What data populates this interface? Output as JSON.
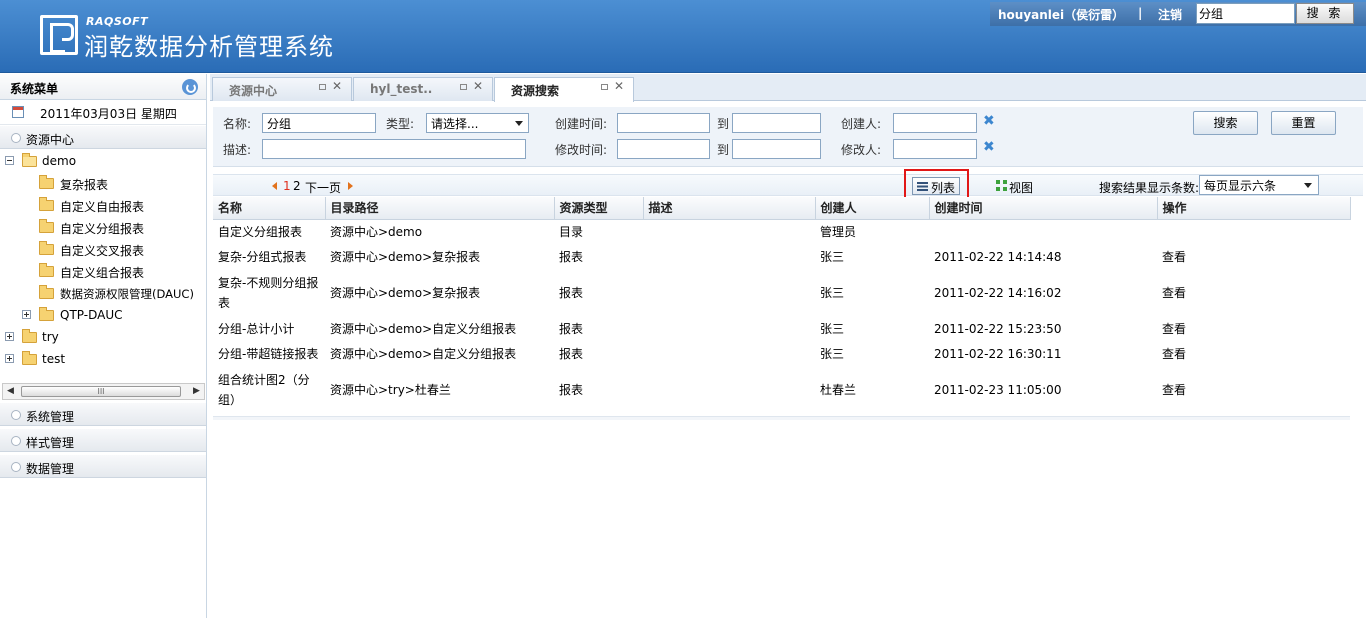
{
  "header": {
    "brand_sub": "RAQSOFT",
    "brand_title": "润乾数据分析管理系统",
    "user": "houyanlei（侯衍雷）",
    "separator": "|",
    "logout": "注销",
    "search_value": "分组",
    "search_button": "搜 索"
  },
  "sidebar": {
    "title": "系统菜单",
    "date": "2011年03月03日  星期四",
    "resource_center": "资源中心",
    "tree": {
      "demo": "demo",
      "items": [
        "复杂报表",
        "自定义自由报表",
        "自定义分组报表",
        "自定义交叉报表",
        "自定义组合报表",
        "数据资源权限管理(DAUC)"
      ],
      "qtp": "QTP-DAUC",
      "try": "try",
      "test": "test"
    },
    "scroll_grip": "III",
    "sections": [
      "系统管理",
      "样式管理",
      "数据管理"
    ]
  },
  "tabs": [
    {
      "label": "资源中心"
    },
    {
      "label": "hyl_test.."
    },
    {
      "label": "资源搜索"
    }
  ],
  "tab_close": "✕",
  "form": {
    "name_label": "名称:",
    "name_value": "分组",
    "type_label": "类型:",
    "type_value": "请选择...",
    "desc_label": "描述:",
    "desc_value": "",
    "created_label": "创建时间:",
    "modified_label": "修改时间:",
    "to_label": "到",
    "creator_label": "创建人:",
    "modifier_label": "修改人:",
    "search_button": "搜索",
    "reset_button": "重置"
  },
  "pager": {
    "page1": "1",
    "page2": "2",
    "next": "下一页",
    "list_label": "列表",
    "view_label": "视图",
    "per_page_label": "搜索结果显示条数:",
    "per_page_value": "每页显示六条"
  },
  "table": {
    "headers": [
      "名称",
      "目录路径",
      "资源类型",
      "描述",
      "创建人",
      "创建时间",
      "操作"
    ],
    "rows": [
      {
        "name": "自定义分组报表",
        "path": "资源中心>demo",
        "type": "目录",
        "desc": "",
        "creator": "管理员",
        "created": "",
        "action": ""
      },
      {
        "name": "复杂-分组式报表",
        "path": "资源中心>demo>复杂报表",
        "type": "报表",
        "desc": "",
        "creator": "张三",
        "created": "2011-02-22 14:14:48",
        "action": "查看"
      },
      {
        "name": "复杂-不规则分组报表",
        "path": "资源中心>demo>复杂报表",
        "type": "报表",
        "desc": "",
        "creator": "张三",
        "created": "2011-02-22 14:16:02",
        "action": "查看"
      },
      {
        "name": "分组-总计小计",
        "path": "资源中心>demo>自定义分组报表",
        "type": "报表",
        "desc": "",
        "creator": "张三",
        "created": "2011-02-22 15:23:50",
        "action": "查看"
      },
      {
        "name": "分组-带超链接报表",
        "path": "资源中心>demo>自定义分组报表",
        "type": "报表",
        "desc": "",
        "creator": "张三",
        "created": "2011-02-22 16:30:11",
        "action": "查看"
      },
      {
        "name": "组合统计图2（分组）",
        "path": "资源中心>try>杜春兰",
        "type": "报表",
        "desc": "",
        "creator": "杜春兰",
        "created": "2011-02-23 11:05:00",
        "action": "查看"
      }
    ]
  }
}
